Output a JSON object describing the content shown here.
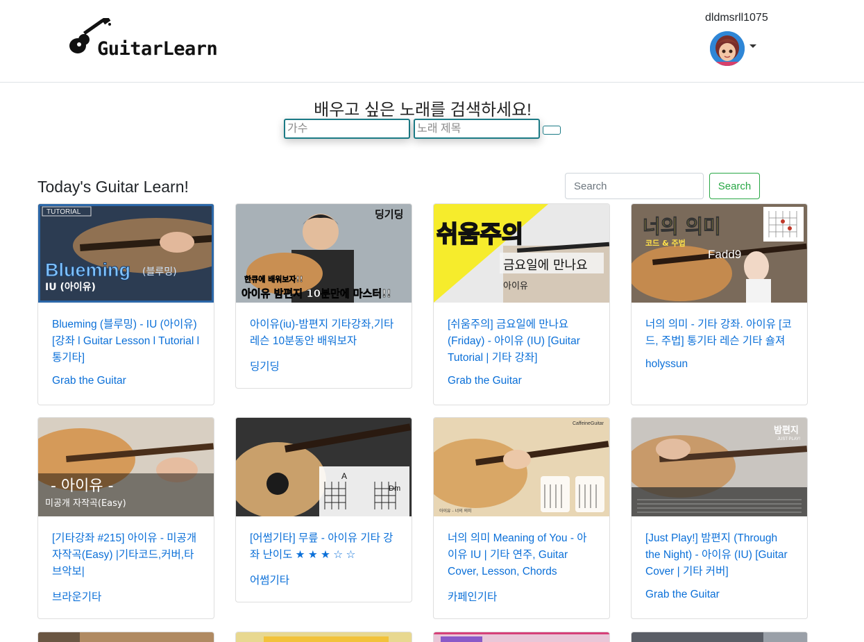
{
  "header": {
    "logo_text": "GuitarLearn",
    "username": "dldmsrll1075"
  },
  "song_search": {
    "title": "배우고 싶은 노래를 검색하세요!",
    "singer_placeholder": "가수",
    "song_placeholder": "노래 제목",
    "submit_label": ""
  },
  "section": {
    "title": "Today's Guitar Learn!",
    "search_placeholder": "Search",
    "search_button": "Search"
  },
  "cards": [
    {
      "title": "Blueming (블루밍) - IU (아이유) [강좌 l Guitar Lesson l Tutorial l 통기타]",
      "channel": "Grab the Guitar",
      "thumb_text": "Blueming",
      "thumb_sub": "IU (아이유)",
      "thumb_tag": "TUTORIAL",
      "thumb_paren": "(블루밍)"
    },
    {
      "title": "아이유(iu)-밤편지 기타강좌,기타레슨 10분동안 배워보자",
      "channel": "딩기딩",
      "thumb_text": "아이유 밤편지 10분만에 마스터!!",
      "thumb_sub": "딩기딩",
      "thumb_small": "한큐에 배워보자!!"
    },
    {
      "title": "[쉬움주의] 금요일에 만나요 (Friday) - 아이유 (IU) [Guitar Tutorial | 기타 강좌]",
      "channel": "Grab the Guitar",
      "thumb_text": "쉬움주의",
      "thumb_sub": "금요일에 만나요",
      "thumb_small": "아이유"
    },
    {
      "title": "너의 의미 - 기타 강좌. 아이유 [코드, 주법] 통기타 레슨 기타 숄져",
      "channel": "holyssun",
      "thumb_text": "너의 의미",
      "thumb_sub": "코드 & 주법",
      "thumb_small": "Fadd9"
    },
    {
      "title": "[기타강좌 #215] 아이유 - 미공개 자작곡(Easy) |기타코드,커버,타브악보|",
      "channel": "브라운기타",
      "thumb_text": "- 아이유 -",
      "thumb_sub": "미공개 자작곡(Easy)"
    },
    {
      "title": "[어썸기타] 무릎 - 아이유 기타 강좌 난이도 ★ ★ ★ ☆ ☆",
      "channel": "어썸기타",
      "thumb_text": "A",
      "thumb_sub": "Dm"
    },
    {
      "title": "너의 의미 Meaning of You - 아이유 IU | 기타 연주, Guitar Cover, Lesson, Chords",
      "channel": "카페인기타",
      "thumb_text": "아이유 - 너의 의미",
      "thumb_sub": "CaffeineGuitar"
    },
    {
      "title": "[Just Play!] 밤편지 (Through the Night) - 아이유 (IU) [Guitar Cover | 기타 커버]",
      "channel": "Grab the Guitar",
      "thumb_text": "밤편지",
      "thumb_sub": "JUST PLAY!"
    }
  ]
}
